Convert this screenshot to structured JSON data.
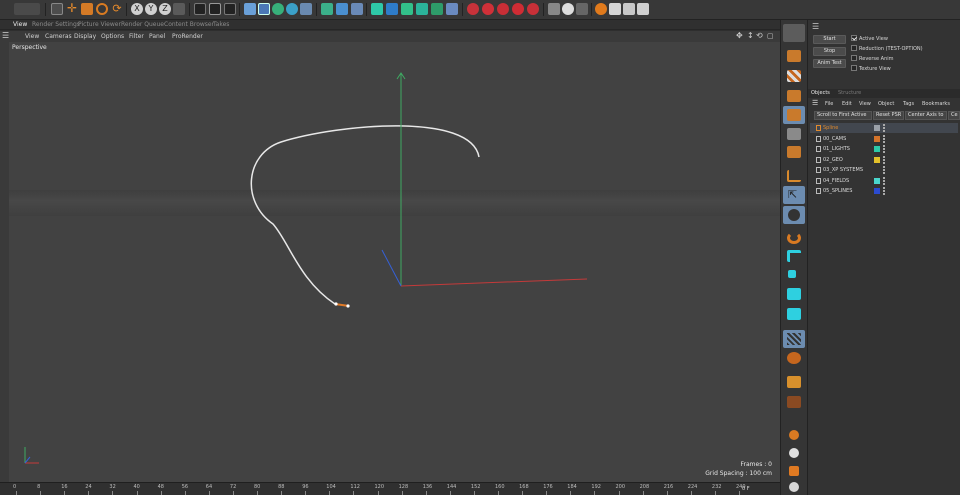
{
  "tabs": [
    "View",
    "Render Settings",
    "Picture Viewer",
    "Render Queue",
    "Content Browser",
    "Takes"
  ],
  "viewport_menu": [
    "View",
    "Cameras",
    "Display",
    "Options",
    "Filter",
    "Panel",
    "ProRender"
  ],
  "viewport": {
    "label": "Perspective",
    "frames_text": "Frames : 0",
    "grid_text": "Grid Spacing : 100 cm"
  },
  "timeline": {
    "ticks": [
      "0",
      "8",
      "16",
      "24",
      "32",
      "40",
      "48",
      "56",
      "64",
      "72",
      "80",
      "88",
      "96",
      "104",
      "112",
      "120",
      "128",
      "136",
      "144",
      "152",
      "160",
      "168",
      "176",
      "184",
      "192",
      "200",
      "208",
      "216",
      "224",
      "232",
      "240"
    ],
    "end_frame": "0 F"
  },
  "script_panel": {
    "start_label": "Start",
    "stop_label": "Stop",
    "anim_test_label": "Anim Test",
    "active_view_label": "Active View",
    "reduction_label": "Reduction (TEST-OPTION)",
    "reverse_anim_label": "Reverse Anim",
    "texture_view_label": "Texture View",
    "active_view_checked": true
  },
  "objects_panel": {
    "tab_objects": "Objects",
    "tab_structure": "Structure",
    "menu": [
      "File",
      "Edit",
      "View",
      "Object",
      "Tags",
      "Bookmarks"
    ],
    "buttons": [
      "Scroll to First Active",
      "Reset PSR",
      "Center Axis to",
      "Ce"
    ],
    "rows": [
      {
        "name": "Spline",
        "color": "#e08a2e",
        "selected": true,
        "tag": "#9aa0a8"
      },
      {
        "name": "00_CAMS",
        "color": "#dcdcdc",
        "selected": false,
        "tag": "#d4732a"
      },
      {
        "name": "01_LIGHTS",
        "color": "#dcdcdc",
        "selected": false,
        "tag": "#2ec9a8"
      },
      {
        "name": "02_GEO",
        "color": "#dcdcdc",
        "selected": false,
        "tag": "#e3c12a"
      },
      {
        "name": "03_XP SYSTEMS",
        "color": "#dcdcdc",
        "selected": false,
        "tag": ""
      },
      {
        "name": "04_FIELDS",
        "color": "#dcdcdc",
        "selected": false,
        "tag": "#4ad6cc"
      },
      {
        "name": "05_SPLINES",
        "color": "#dcdcdc",
        "selected": false,
        "tag": "#2b4bd0"
      }
    ]
  }
}
